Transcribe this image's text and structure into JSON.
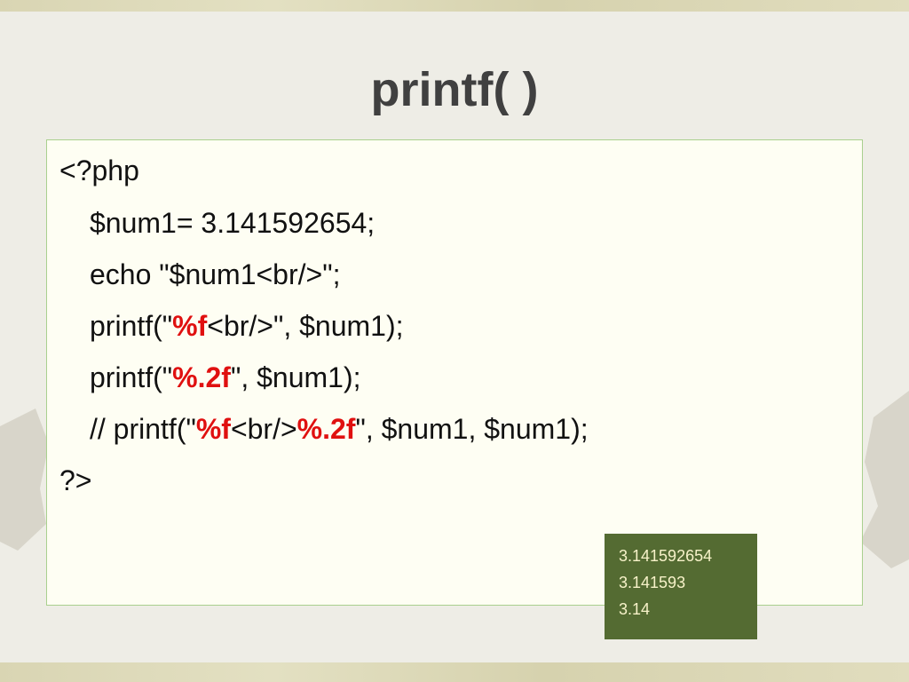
{
  "slide": {
    "title": "printf( )"
  },
  "code": {
    "line1": "<?php",
    "line2": "$num1= 3.141592654;",
    "line3": "echo \"$num1<br/>\";",
    "line4": {
      "prefix": "printf(\"",
      "fmt": "%f",
      "suffix": "<br/>\", $num1);"
    },
    "line5": {
      "prefix": "printf(\"",
      "fmt": "%.2f",
      "suffix": "\", $num1);"
    },
    "line6": {
      "prefix": "// printf(\"",
      "fmt1": "%f",
      "middle": "<br/>",
      "fmt2": "%.2f",
      "suffix": "\", $num1, $num1);"
    },
    "line7": "?>"
  },
  "output": {
    "lines": [
      "3.141592654",
      "3.141593",
      "3.14"
    ]
  },
  "colors": {
    "title": "#404040",
    "code_text": "#111111",
    "format_highlight": "#e01010",
    "box_border": "#a9d08e",
    "box_background": "#fefef3",
    "output_background": "#546b32",
    "output_text": "#f7f2c9"
  }
}
